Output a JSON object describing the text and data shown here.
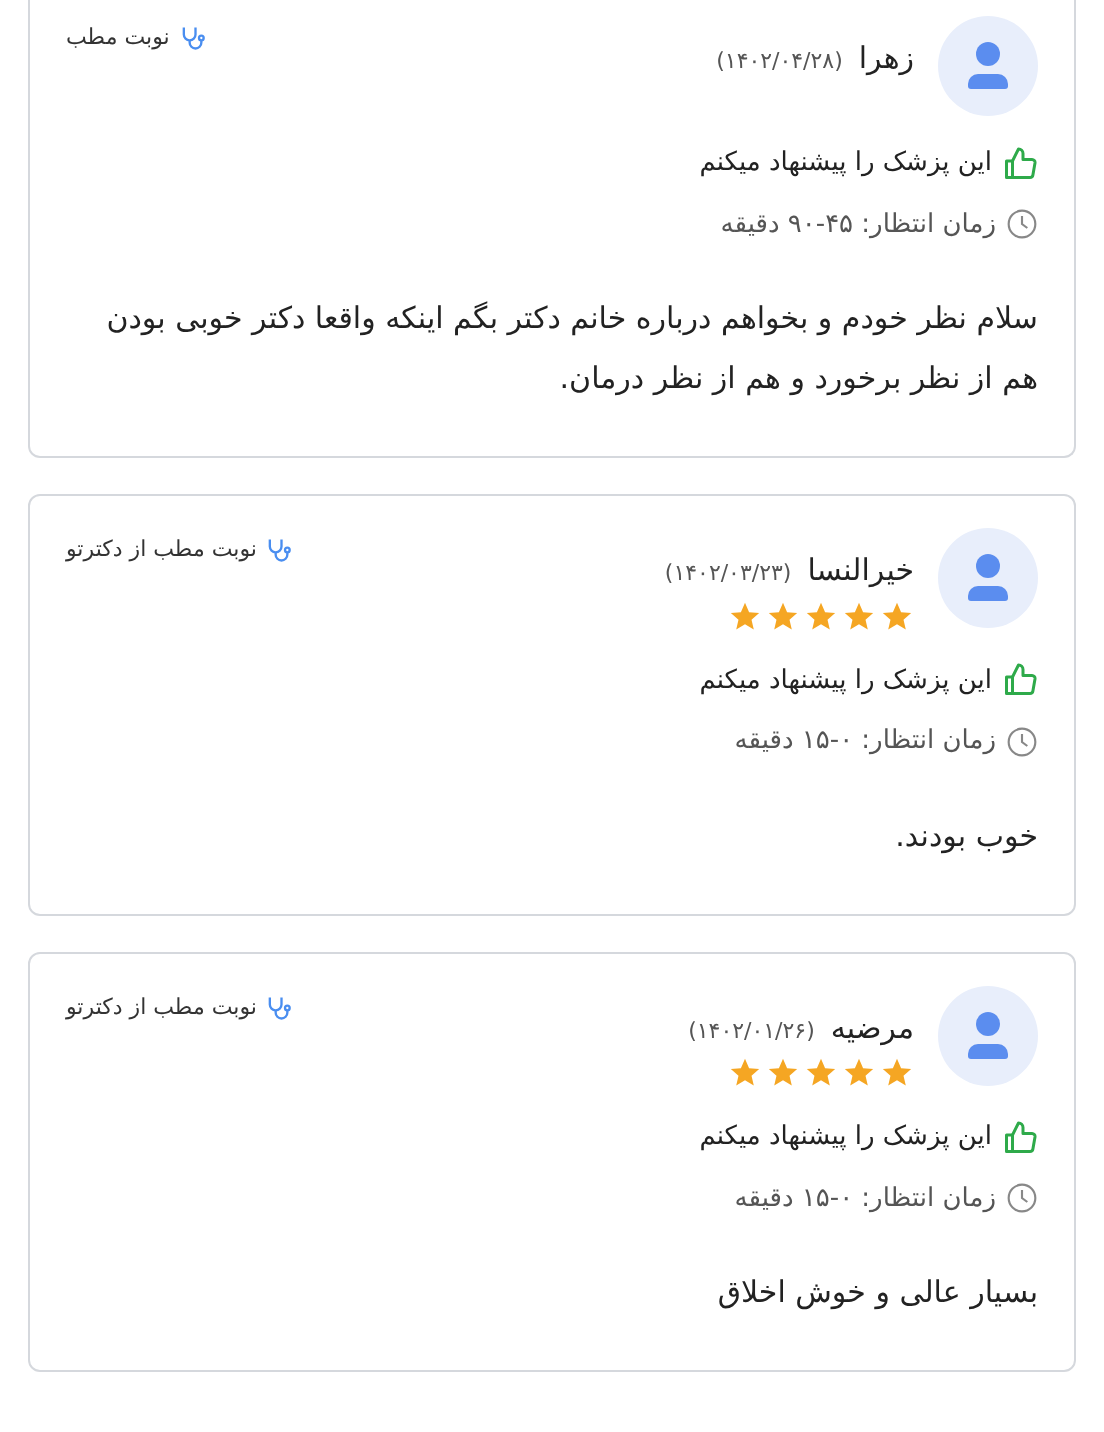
{
  "reviews": [
    {
      "name": "زهرا",
      "date": "(۱۴۰۲/۰۴/۲۸)",
      "booking": "نوبت مطب",
      "recommend": "این پزشک را پیشنهاد میکنم",
      "wait": "زمان انتظار: ۴۵-۹۰ دقیقه",
      "comment": "سلام نظر خودم و بخواهم درباره خانم دکتر بگم اینکه واقعا دکتر خوبی بودن هم از نظر برخورد و هم از نظر درمان."
    },
    {
      "name": "خیرالنسا",
      "date": "(۱۴۰۲/۰۳/۲۳)",
      "stars": 5,
      "booking": "نوبت مطب از دکترتو",
      "recommend": "این پزشک را پیشنهاد میکنم",
      "wait": "زمان انتظار: ۰-۱۵ دقیقه",
      "comment": "خوب بودند."
    },
    {
      "name": "مرضیه",
      "date": "(۱۴۰۲/۰۱/۲۶)",
      "stars": 5,
      "booking": "نوبت مطب از دکترتو",
      "recommend": "این پزشک را پیشنهاد میکنم",
      "wait": "زمان انتظار: ۰-۱۵ دقیقه",
      "comment": "بسیار عالی و خوش اخلاق"
    }
  ]
}
